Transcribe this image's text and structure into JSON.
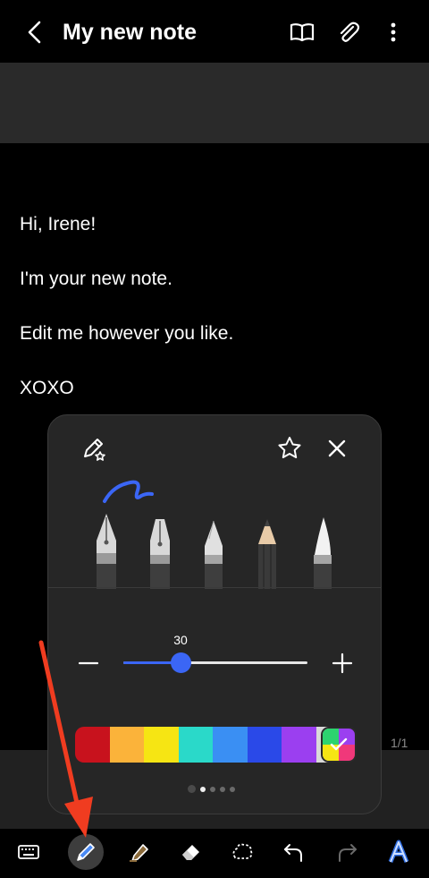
{
  "header": {
    "title": "My new note",
    "back_icon": "chevron-left-icon",
    "actions": [
      "reading-mode-icon",
      "attach-icon",
      "more-icon"
    ]
  },
  "note": {
    "lines": [
      "Hi, Irene!",
      "I'm your new note.",
      "Edit me however you like.",
      "XOXO"
    ],
    "page_indicator": "1/1"
  },
  "pen_panel": {
    "pens": [
      "fountain-pen",
      "calligraphy-pen",
      "pen",
      "pencil",
      "brush"
    ],
    "selected_pen": "fountain-pen",
    "size": {
      "value": "30",
      "level": 0.31
    },
    "colors": [
      "#c8121d",
      "#fbb33a",
      "#f6e513",
      "#2ad9c9",
      "#3a8ff3",
      "#2a49e8",
      "#9b3ff0",
      "#d9d9d9"
    ],
    "page_dots": 4,
    "active_dot": 0
  },
  "toolbar": {
    "items": [
      "keyboard-icon",
      "pen-icon",
      "highlighter-icon",
      "eraser-icon",
      "lasso-icon",
      "undo-icon",
      "redo-icon",
      "text-style-icon"
    ],
    "active": "pen-icon"
  },
  "annotation": {
    "color": "#f03c20"
  }
}
